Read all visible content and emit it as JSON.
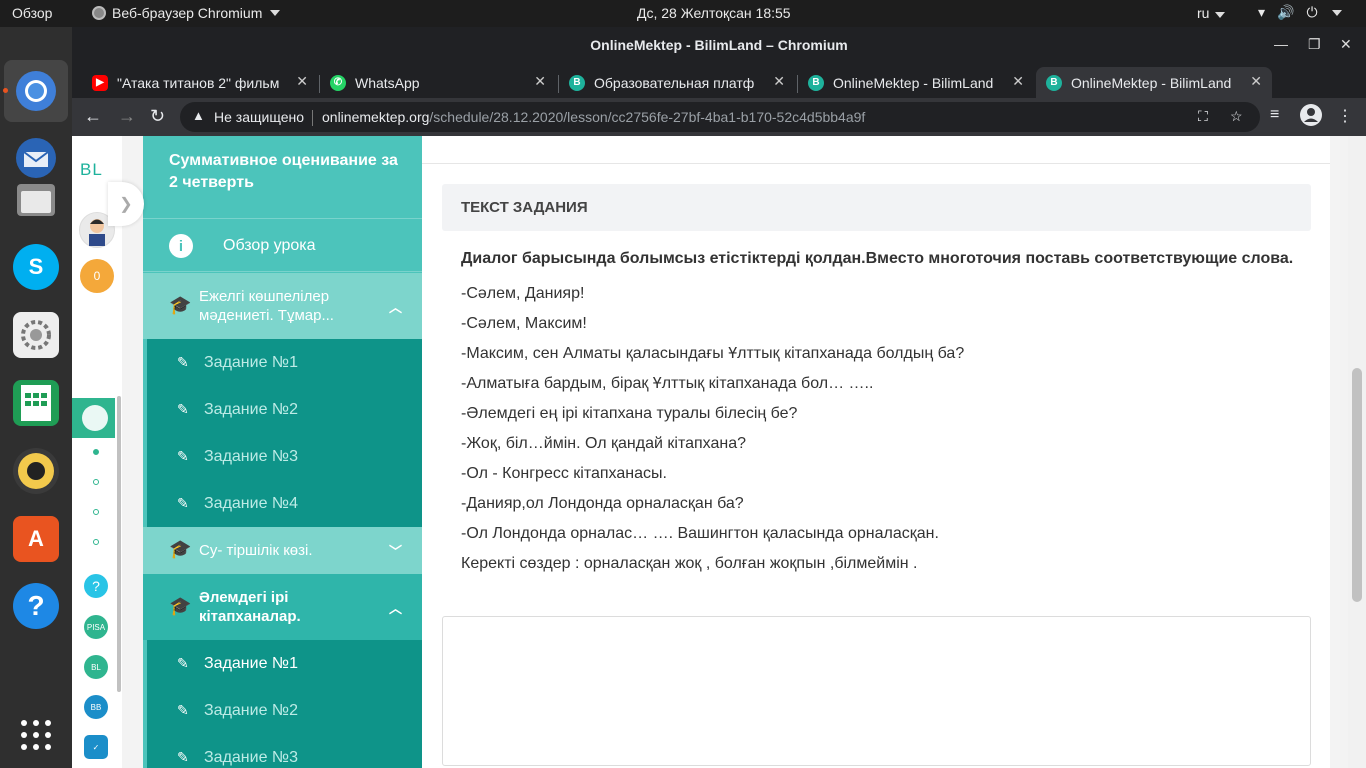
{
  "system": {
    "overview": "Обзор",
    "app_menu": "Веб-браузер Chromium",
    "clock": "Дс, 28 Желтоқсан  18:55",
    "lang": "ru"
  },
  "window": {
    "title": "OnlineMektep - BilimLand – Chromium"
  },
  "tabs": [
    {
      "label": "\"Атака титанов 2\" фильм",
      "icon": "youtube-icon"
    },
    {
      "label": "WhatsApp",
      "icon": "whatsapp-icon"
    },
    {
      "label": "Образовательная платф",
      "icon": "bilimland-icon"
    },
    {
      "label": "OnlineMektep - BilimLand",
      "icon": "bilimland-icon"
    },
    {
      "label": "OnlineMektep - BilimLand",
      "icon": "bilimland-icon"
    }
  ],
  "omnibox": {
    "security": "Не защищено",
    "url_host": "onlinemektep.org",
    "url_path": "/schedule/28.12.2020/lesson/cc2756fe-27bf-4ba1-b170-52c4d5bb4a9f"
  },
  "rail": {
    "logo": "BL",
    "coins": "0"
  },
  "sidebar": {
    "title": "Суммативное оценивание за 2 четверть",
    "overview": "Обзор урока",
    "section1": "Ежелгі көшпелілер мәдениеті. Тұмар...",
    "section1_items": [
      "Задание №1",
      "Задание №2",
      "Задание №3",
      "Задание №4"
    ],
    "section2": "Су- тіршілік көзі.",
    "section3": "Әлемдегі ірі кітапханалар.",
    "section3_items": [
      "Задание №1",
      "Задание №2",
      "Задание №3"
    ]
  },
  "task": {
    "header": "ТЕКСТ ЗАДАНИЯ",
    "question": "Диалог барысында болымсыз етістіктерді қолдан.Вместо многоточия поставь соответствующие слова.",
    "lines": [
      "-Сәлем, Данияр!",
      "-Сәлем, Максим!",
      "-Максим, сен Алматы қаласындағы Ұлттық кітапханада болдың ба?",
      "-Алматыға бардым, бірақ Ұлттық кітапханада бол… …..",
      "-Әлемдегі ең ірі кітапхана туралы білесің бе?",
      "-Жоқ, біл…ймін. Ол қандай кітапхана?",
      "-Ол - Конгресс кітапханасы.",
      "-Данияр,ол Лондонда орналасқан ба?",
      "-Ол Лондонда орналас… …. Вашингтон қаласында орналасқан.",
      "Керекті сөздер : орналасқан жоқ , болған жоқпын ,білмеймін ."
    ]
  }
}
